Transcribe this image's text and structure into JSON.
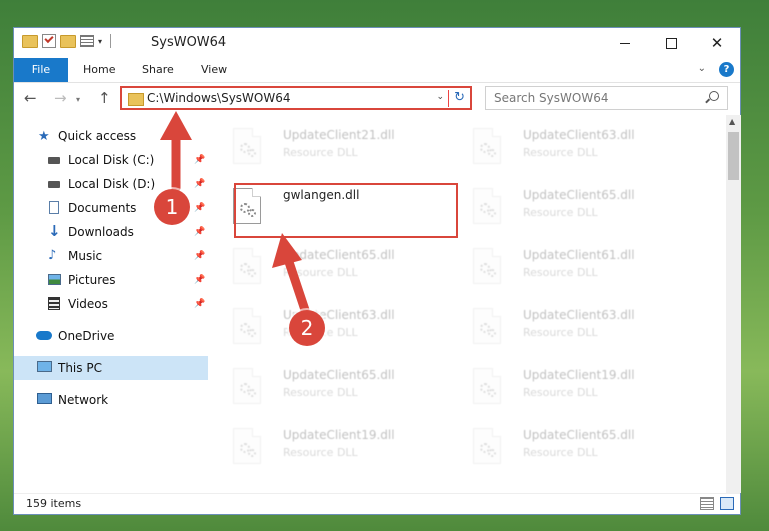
{
  "window": {
    "title": "SysWOW64"
  },
  "ribbon": {
    "tabs": [
      "File",
      "Home",
      "Share",
      "View"
    ]
  },
  "address": {
    "path": "C:\\Windows\\SysWOW64"
  },
  "search": {
    "placeholder": "Search SysWOW64"
  },
  "sidebar": {
    "quick_access": "Quick access",
    "items": [
      {
        "label": "Local Disk (C:)",
        "icon": "drive-icon",
        "pinned": true
      },
      {
        "label": "Local Disk (D:)",
        "icon": "drive-icon",
        "pinned": true
      },
      {
        "label": "Documents",
        "icon": "documents-icon",
        "pinned": true
      },
      {
        "label": "Downloads",
        "icon": "download-icon",
        "pinned": true
      },
      {
        "label": "Music",
        "icon": "music-icon",
        "pinned": true
      },
      {
        "label": "Pictures",
        "icon": "pictures-icon",
        "pinned": true
      },
      {
        "label": "Videos",
        "icon": "video-icon",
        "pinned": true
      }
    ],
    "onedrive": "OneDrive",
    "this_pc": "This PC",
    "network": "Network"
  },
  "files": {
    "highlighted": {
      "name": "gwlangen.dll"
    },
    "left_column": [
      {
        "name": "UpdateClient21.dll",
        "type": "Resource DLL"
      },
      {
        "name": "gwlangen.dll",
        "type": ""
      },
      {
        "name": "UpdateClient65.dll",
        "type": "Resource DLL"
      },
      {
        "name": "UpdateClient63.dll",
        "type": "Resource DLL"
      },
      {
        "name": "UpdateClient65.dll",
        "type": "Resource DLL"
      },
      {
        "name": "UpdateClient19.dll",
        "type": "Resource DLL"
      }
    ],
    "right_column": [
      {
        "name": "UpdateClient63.dll",
        "type": "Resource DLL"
      },
      {
        "name": "UpdateClient65.dll",
        "type": "Resource DLL"
      },
      {
        "name": "UpdateClient61.dll",
        "type": "Resource DLL"
      },
      {
        "name": "UpdateClient63.dll",
        "type": "Resource DLL"
      },
      {
        "name": "UpdateClient19.dll",
        "type": "Resource DLL"
      },
      {
        "name": "UpdateClient65.dll",
        "type": "Resource DLL"
      }
    ]
  },
  "status": {
    "count": "159 items"
  },
  "annotations": {
    "step1": "1",
    "step2": "2"
  },
  "colors": {
    "accent": "#1979ca",
    "highlight": "#d9463b",
    "selected": "#cce4f7"
  }
}
